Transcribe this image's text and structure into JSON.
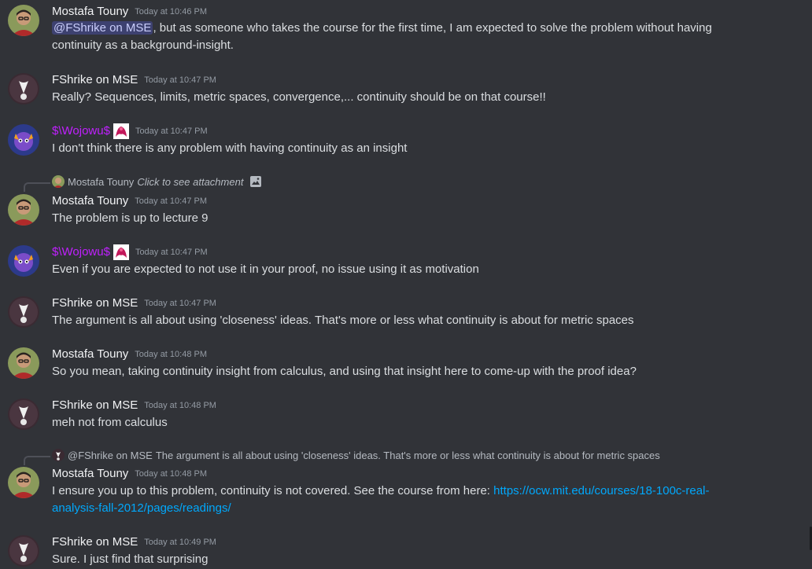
{
  "colors": {
    "background": "#313338",
    "author_default": "#f2f3f5",
    "author_purple": "#c020ff",
    "timestamp": "#949ba4",
    "link": "#00a8fc",
    "mention_bg": "#3c4270"
  },
  "messages": [
    {
      "author": "Mostafa Touny",
      "timestamp": "Today at 10:46 PM",
      "mention": "@FShrike on MSE",
      "text": ", but as someone who takes the course for the first time, I am expected to solve the problem without having continuity as a background-insight."
    },
    {
      "author": "FShrike on MSE",
      "timestamp": "Today at 10:47 PM",
      "text": "Really? Sequences, limits, metric spaces, convergence,... continuity should be on that course!!"
    },
    {
      "author": "$\\Wojowu$",
      "timestamp": "Today at 10:47 PM",
      "text": "I don't think there is any problem with having continuity as an insight"
    },
    {
      "reply_author": "Mostafa Touny",
      "reply_text": "Click to see attachment",
      "author": "Mostafa Touny",
      "timestamp": "Today at 10:47 PM",
      "text": "The problem is up to lecture 9"
    },
    {
      "author": "$\\Wojowu$",
      "timestamp": "Today at 10:47 PM",
      "text": "Even if you are expected to not use it in your proof, no issue using it as motivation"
    },
    {
      "author": "FShrike on MSE",
      "timestamp": "Today at 10:47 PM",
      "text": "The argument is all about using 'closeness' ideas. That's more or less what continuity is about for metric spaces"
    },
    {
      "author": "Mostafa Touny",
      "timestamp": "Today at 10:48 PM",
      "text": "So you mean, taking continuity insight from calculus, and using that insight here to come-up with the proof idea?"
    },
    {
      "author": "FShrike on MSE",
      "timestamp": "Today at 10:48 PM",
      "text": "meh not from calculus"
    },
    {
      "reply_author": "@FShrike on MSE",
      "reply_text": "The argument is all about using 'closeness' ideas. That's more or less what continuity is about for metric spaces",
      "author": "Mostafa Touny",
      "timestamp": "Today at 10:48 PM",
      "text": "I ensure you up to this problem, continuity is not covered. See the course from here: ",
      "link": "https://ocw.mit.edu/courses/18-100c-real-analysis-fall-2012/pages/readings/"
    },
    {
      "author": "FShrike on MSE",
      "timestamp": "Today at 10:49 PM",
      "text": "Sure. I just find that surprising"
    }
  ]
}
